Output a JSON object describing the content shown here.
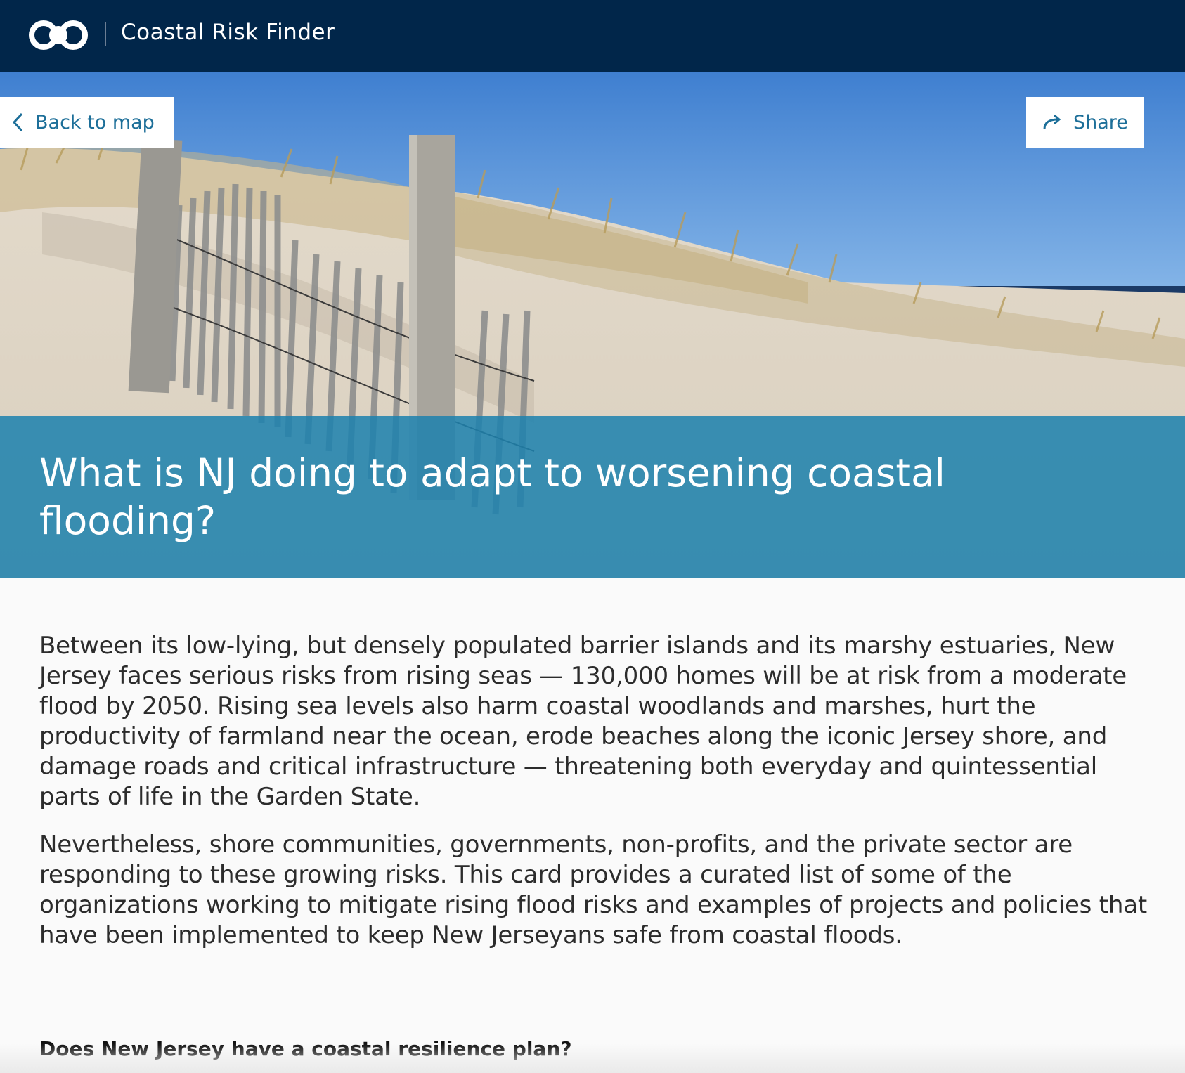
{
  "header": {
    "app_title": "Coastal Risk Finder",
    "logo_icon": "linked-circles-logo"
  },
  "hero": {
    "back_label": "Back to map",
    "share_label": "Share",
    "title": "What is NJ doing to adapt to worsening coastal flooding?"
  },
  "article": {
    "paragraphs": [
      "Between its low-lying, but densely populated barrier islands and its marshy estuaries, New Jersey faces serious risks from rising seas — 130,000 homes will be at risk from a moderate flood by 2050. Rising sea levels also harm coastal woodlands and marshes, hurt the productivity of farmland near the ocean, erode beaches along the iconic Jersey shore, and damage roads and critical infrastructure — threatening both everyday and quintessential parts of life in the Garden State.",
      "Nevertheless, shore communities, governments, non-profits, and the private sector are responding to these growing risks. This card provides a curated list of some of the organizations working to mitigate rising flood risks and examples of projects and policies that have been implemented to keep New Jerseyans safe from coastal floods."
    ],
    "faq_heading": "Does New Jersey have a coastal resilience plan?"
  },
  "colors": {
    "topbar": "#01264a",
    "title_band": "#1d81ae",
    "button_text": "#1d6f99"
  }
}
